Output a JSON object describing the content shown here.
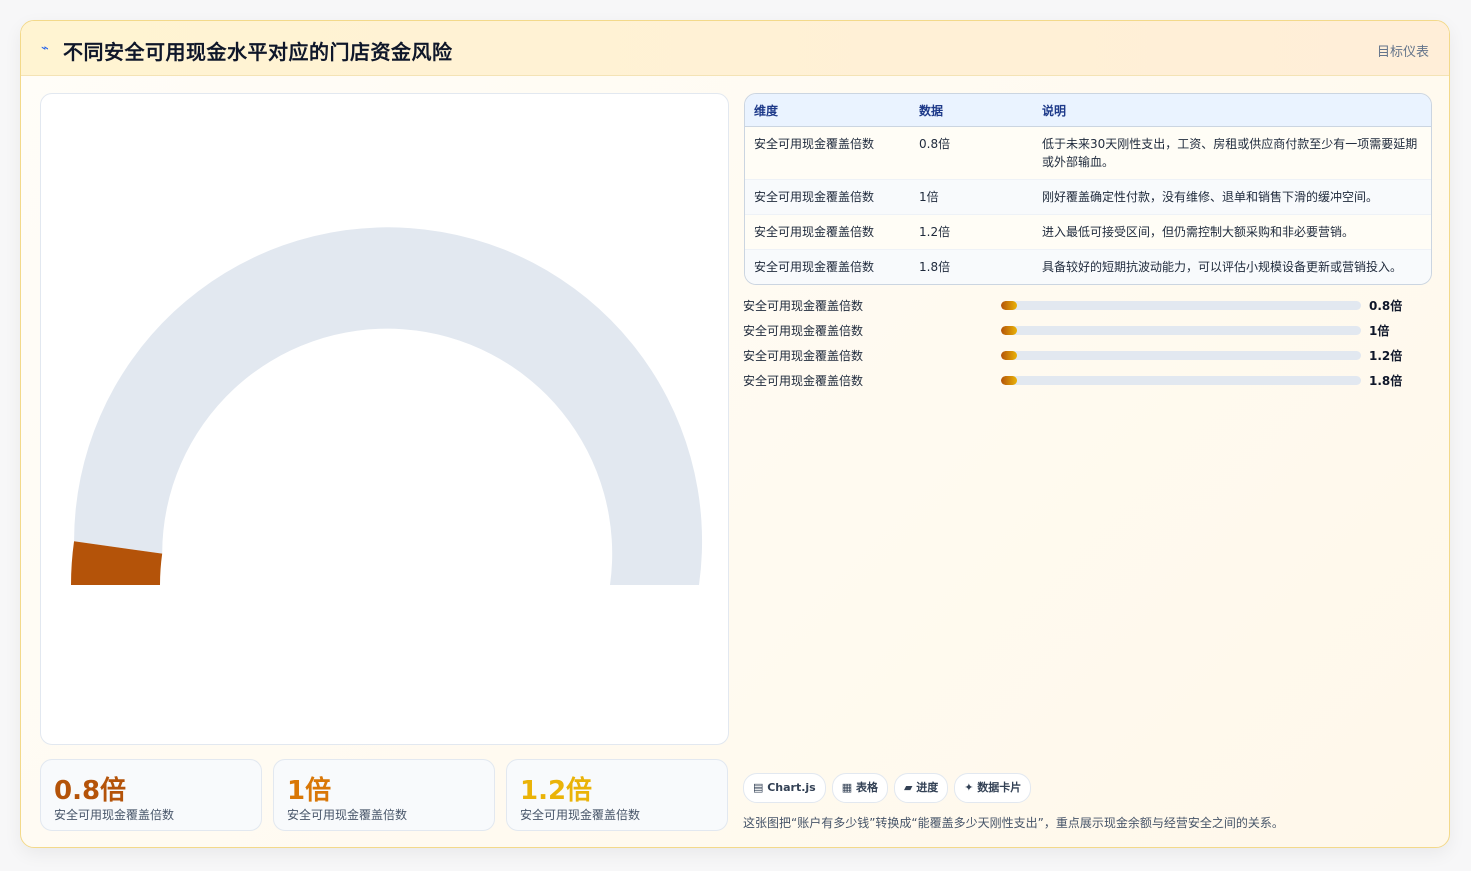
{
  "header": {
    "title": "不同安全可用现金水平对应的门店资金风险",
    "tag": "目标仪表"
  },
  "colors": {
    "gauge_track": "#e2e8f0",
    "gauge_fill": "#b45309",
    "stat_1": "#b45309",
    "stat_2": "#d97706",
    "stat_3": "#eab308"
  },
  "table": {
    "headers": [
      "维度",
      "数据",
      "说明"
    ],
    "rows": [
      {
        "dim": "安全可用现金覆盖倍数",
        "value": "0.8倍",
        "desc": "低于未来30天刚性支出，工资、房租或供应商付款至少有一项需要延期或外部输血。"
      },
      {
        "dim": "安全可用现金覆盖倍数",
        "value": "1倍",
        "desc": "刚好覆盖确定性付款，没有维修、退单和销售下滑的缓冲空间。"
      },
      {
        "dim": "安全可用现金覆盖倍数",
        "value": "1.2倍",
        "desc": "进入最低可接受区间，但仍需控制大额采购和非必要营销。"
      },
      {
        "dim": "安全可用现金覆盖倍数",
        "value": "1.8倍",
        "desc": "具备较好的短期抗波动能力，可以评估小规模设备更新或营销投入。"
      }
    ]
  },
  "progress": [
    {
      "label": "安全可用现金覆盖倍数",
      "value_text": "0.8倍",
      "fill": 0.045
    },
    {
      "label": "安全可用现金覆盖倍数",
      "value_text": "1倍",
      "fill": 0.045
    },
    {
      "label": "安全可用现金覆盖倍数",
      "value_text": "1.2倍",
      "fill": 0.045
    },
    {
      "label": "安全可用现金覆盖倍数",
      "value_text": "1.8倍",
      "fill": 0.045
    }
  ],
  "stats": [
    {
      "value": "0.8倍",
      "label": "安全可用现金覆盖倍数"
    },
    {
      "value": "1倍",
      "label": "安全可用现金覆盖倍数"
    },
    {
      "value": "1.2倍",
      "label": "安全可用现金覆盖倍数"
    }
  ],
  "chips": [
    "▤ Chart.js",
    "▦ 表格",
    "▰ 进度",
    "✦ 数据卡片"
  ],
  "note": "这张图把“账户有多少钱”转换成“能覆盖多少天刚性支出”，重点展示现金余额与经营安全之间的关系。",
  "chart_data": {
    "type": "gauge",
    "value": 0.8,
    "min": 0,
    "max": 18,
    "title": ""
  }
}
